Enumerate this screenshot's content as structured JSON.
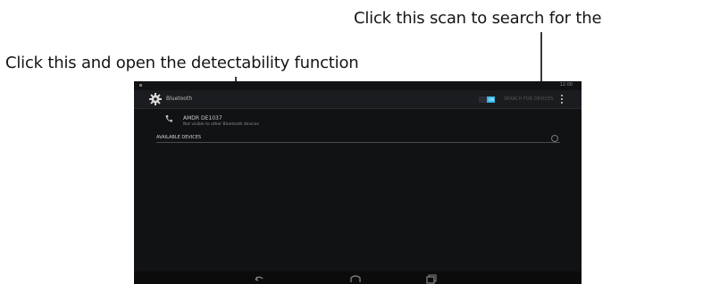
{
  "annotations": {
    "scan_callout": "Click this scan to search for the",
    "detect_callout": "Click this and open the detectability function"
  },
  "actionbar": {
    "icon": "gear-icon",
    "title": "Bluetooth",
    "toggle_state": "ON",
    "scan_label": "SEARCH FOR DEVICES",
    "overflow_icon": "overflow-menu-icon"
  },
  "paired_device": {
    "icon": "phone-icon",
    "name": "AMDR DE1037",
    "subtitle": "Not visible to other Bluetooth devices"
  },
  "available_devices": {
    "header": "AVAILABLE DEVICES"
  },
  "status_bar": {
    "time": "12:00"
  },
  "colors": {
    "screen_bg": "#111214",
    "accent": "#33b5e5"
  },
  "navbar": {
    "icons": [
      "back-icon",
      "home-icon",
      "recent-apps-icon"
    ]
  }
}
